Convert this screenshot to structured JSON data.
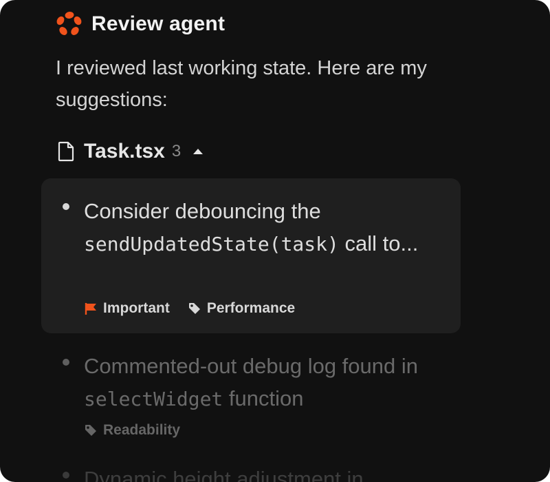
{
  "agent": {
    "name": "Review agent",
    "logo_icon": "flower-logo-icon",
    "accent_color": "#f0531c"
  },
  "intro": "I reviewed last working state. Here are my suggestions:",
  "file": {
    "name": "Task.tsx",
    "count": "3",
    "icon": "file-icon",
    "toggle_icon": "caret-up-icon"
  },
  "suggestions": [
    {
      "text_before": "Consider debouncing the ",
      "code": "sendUpdatedState(task)",
      "text_after": " call to...",
      "tags": [
        {
          "label": "Important",
          "icon": "flag-icon",
          "color": "#f0531c"
        },
        {
          "label": "Performance",
          "icon": "tag-icon"
        }
      ]
    },
    {
      "text_before": "Commented-out debug log found in ",
      "code": "selectWidget",
      "text_after": " function",
      "tags": [
        {
          "label": "Readability",
          "icon": "tag-icon"
        }
      ]
    },
    {
      "text_before": "Dynamic height adjustment in"
    }
  ]
}
